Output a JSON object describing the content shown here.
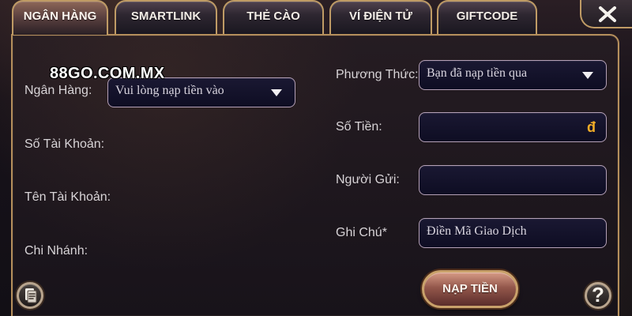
{
  "tabs": [
    {
      "label": "NGÂN HÀNG",
      "active": true
    },
    {
      "label": "SMARTLINK",
      "active": false
    },
    {
      "label": "THẺ CÀO",
      "active": false
    },
    {
      "label": "VÍ ĐIỆN TỬ",
      "active": false
    },
    {
      "label": "GIFTCODE",
      "active": false
    }
  ],
  "watermark": "88GO.COM.MX",
  "left_form": {
    "bank_label": "Ngân Hàng:",
    "bank_placeholder": "Vui lòng nạp tiền vào",
    "account_number_label": "Số Tài Khoản:",
    "account_name_label": "Tên Tài Khoản:",
    "branch_label": "Chi Nhánh:"
  },
  "right_form": {
    "method_label": "Phương Thức:",
    "method_value": "Bạn đã nạp tiền qua",
    "amount_label": "Số Tiền:",
    "currency_symbol": "đ",
    "sender_label": "Người Gửi:",
    "note_label": "Ghi Chú*",
    "note_placeholder": "Điền Mã Giao Dịch"
  },
  "actions": {
    "submit_label": "NẠP TIỀN",
    "help_symbol": "?"
  },
  "icons": {
    "close": "close-icon",
    "history": "history-icon",
    "dropdown": "chevron-down-icon",
    "help": "help-icon"
  },
  "colors": {
    "accent_gold": "#bf9b65",
    "active_tab": "#7b5a50",
    "field_bg": "#15142c",
    "currency": "#f3ad27",
    "submit_button": "#8e5349"
  }
}
